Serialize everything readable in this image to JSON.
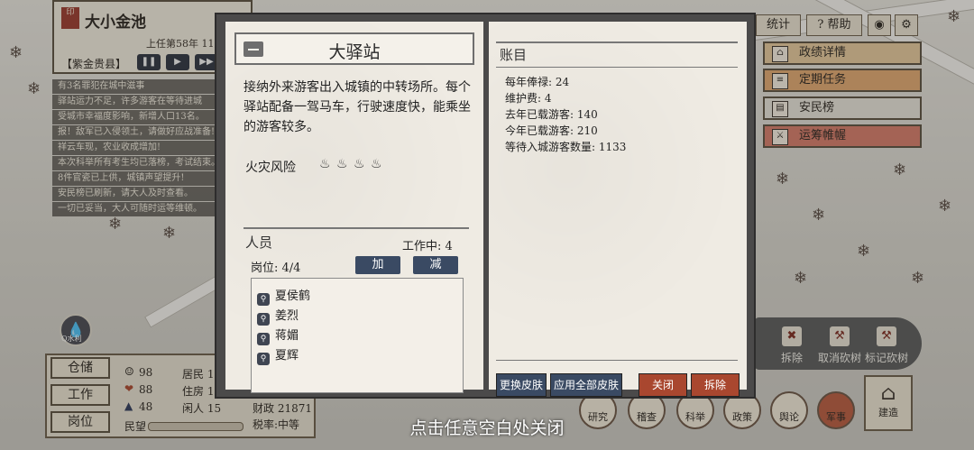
{
  "city": {
    "seal": "大小金池",
    "name": "大小金池",
    "tenure": "上任第58年 11月",
    "county": "【紫金贵县】",
    "controls": [
      "pause",
      "play",
      "fast-forward"
    ]
  },
  "feed": [
    "有3名罪犯在城中滋事",
    "驿站运力不足，许多游客在等待进城",
    "受城市幸福度影响，新增人口13名。",
    "报！敌军已入侵领土，请做好应战准备!",
    "祥云车现，农业收成增加!",
    "本次科举所有考生均已落榜，考试结束。",
    "8件官瓷已上供，城镇声望提升!",
    "安民榜已刷新，请大人及时查看。",
    "一切已妥当，大人可随时运等维顿。"
  ],
  "top_right": {
    "stats": "统计",
    "help": "帮助"
  },
  "right_panel": [
    "政绩详情",
    "定期任务",
    "安民榜",
    "运筹帷幄"
  ],
  "left_buttons": [
    "仓储",
    "工作",
    "岗位"
  ],
  "left_stats": {
    "happy": "98",
    "health": "88",
    "other": "48",
    "residents": "居民 11",
    "housing": "住房 13",
    "idle": "闲人 15",
    "sentiment": "民望",
    "finance": "财政 21871",
    "tax": "税率:中等",
    "water": "Q水利"
  },
  "toolbar": {
    "items": [
      "拆除",
      "取消砍树",
      "标记砍树"
    ],
    "circles": [
      "研究",
      "稽查",
      "科举",
      "政策",
      "舆论",
      "军事"
    ],
    "build": "建造"
  },
  "modal": {
    "title": "大驿站",
    "description": "接纳外来游客出入城镇的中转场所。每个驿站配备一驾马车，行驶速度快，能乘坐的游客较多。",
    "fire_label": "火灾风险",
    "fire_icons": "🔥🔥🔥🔥",
    "staff": {
      "heading": "人员",
      "working": "工作中: 4",
      "positions": "岗位: 4/4",
      "add": "加",
      "remove": "减",
      "people": [
        "夏侯鹤",
        "姜烈",
        "蒋媚",
        "夏辉"
      ]
    },
    "ledger": {
      "heading": "账目",
      "rows": [
        "每年俸禄: 24",
        "维护费: 4",
        "去年已载游客: 140",
        "今年已载游客: 210",
        "等待入城游客数量: 1133"
      ]
    },
    "buttons": {
      "change_skin": "更换皮肤",
      "apply_all": "应用全部皮肤",
      "close": "关闭",
      "demolish": "拆除"
    }
  },
  "hint": "点击任意空白处关闭",
  "colors": {
    "button_blue": "#3a4a63",
    "button_red": "#a9472f",
    "modal_frame": "#4b4a4a",
    "paper": "#efebe3"
  }
}
